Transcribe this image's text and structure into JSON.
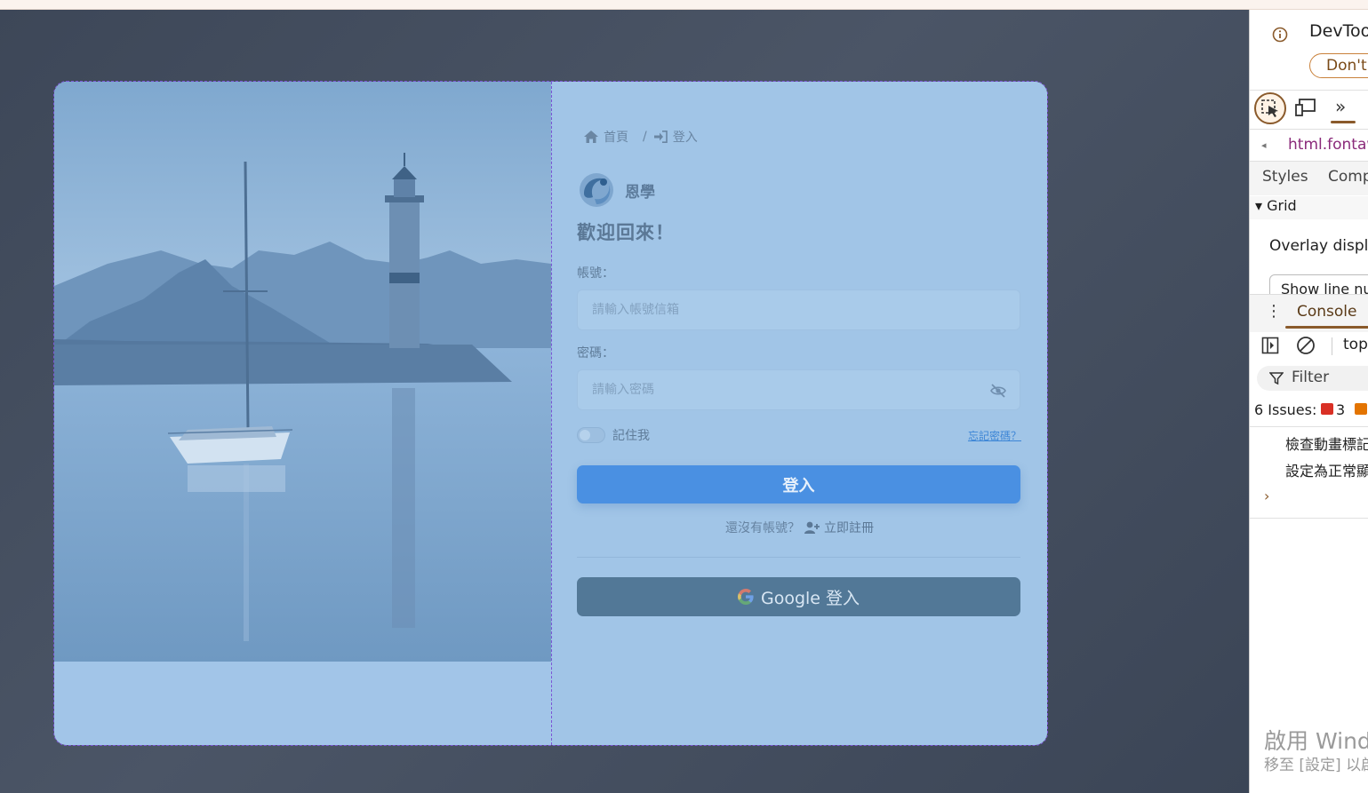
{
  "breadcrumb": {
    "home": "首頁",
    "separator": "/",
    "current": "登入"
  },
  "brand": {
    "name": "恩學"
  },
  "welcome": "歡迎回來！",
  "account": {
    "label": "帳號：",
    "placeholder": "請輸入帳號信箱",
    "value": ""
  },
  "password": {
    "label": "密碼：",
    "placeholder": "請輸入密碼",
    "value": ""
  },
  "remember": {
    "label": "記住我",
    "checked": false
  },
  "forgot_link": "忘記密碼？",
  "login_button": "登入",
  "register": {
    "prompt": "還沒有帳號？",
    "link": "立即註冊"
  },
  "google_button": "Google 登入",
  "icons": [
    "home-icon",
    "sign-in-icon",
    "eye-slash-icon",
    "user-plus-icon",
    "google-icon"
  ],
  "devtools": {
    "banner_title": "DevToo",
    "dont_button": "Don't",
    "breadcrumb_node": "html.fontaw",
    "tabs": [
      "Styles",
      "Comp"
    ],
    "grid_section": "Grid",
    "overlay_label": "Overlay displa",
    "show_line_label": "Show line nu",
    "console_tab": "Console",
    "context": "top",
    "filter_label": "Filter",
    "issues_label": "6 Issues:",
    "issues_error_count": "3",
    "message_1": "檢查動畫標記",
    "message_2": "設定為正常顯",
    "watermark_title": "啟用 Wind",
    "watermark_sub": "移至 [設定] 以啟"
  },
  "colors": {
    "card_bg": "#a1c5e7",
    "login_button": "#4a90e2",
    "google_button": "#527897",
    "link": "#3d86d6",
    "devtools_accent": "#8a5a2b"
  }
}
